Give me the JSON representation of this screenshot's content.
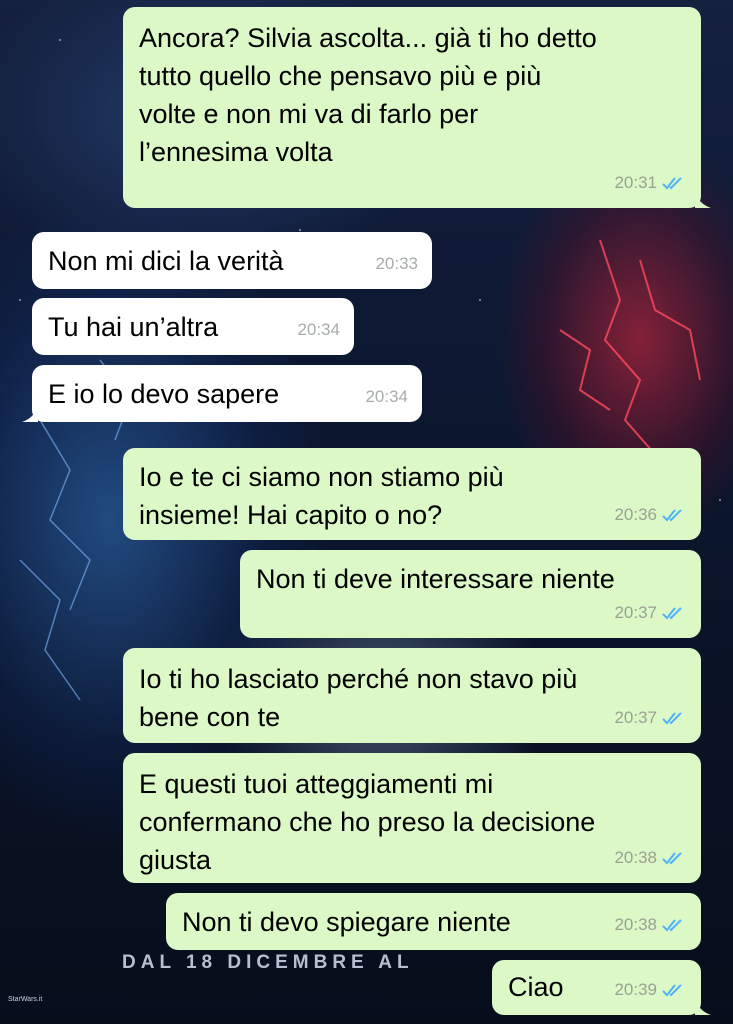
{
  "chat": {
    "messages": [
      {
        "dir": "out",
        "lines": [
          "Ancora? Silvia ascolta... già ti ho detto",
          "tutto quello che pensavo più e più",
          "volte e non mi va di farlo per",
          "l’ennesima volta"
        ],
        "time": "20:31",
        "read": true
      },
      {
        "dir": "in",
        "lines": [
          "Non mi dici la verità"
        ],
        "time": "20:33"
      },
      {
        "dir": "in",
        "lines": [
          "Tu hai un’altra"
        ],
        "time": "20:34"
      },
      {
        "dir": "in",
        "lines": [
          "E io lo devo sapere"
        ],
        "time": "20:34"
      },
      {
        "dir": "out",
        "lines": [
          "Io e te ci siamo non stiamo più",
          "insieme! Hai capito o no?"
        ],
        "time": "20:36",
        "read": true
      },
      {
        "dir": "out",
        "lines": [
          "Non ti deve interessare niente"
        ],
        "time": "20:37",
        "read": true
      },
      {
        "dir": "out",
        "lines": [
          "Io ti ho lasciato perché non stavo più",
          "bene con te"
        ],
        "time": "20:37",
        "read": true
      },
      {
        "dir": "out",
        "lines": [
          "E questi tuoi atteggiamenti mi",
          "confermano che ho preso la decisione",
          "giusta"
        ],
        "time": "20:38",
        "read": true
      },
      {
        "dir": "out",
        "lines": [
          "Non ti devo spiegare niente"
        ],
        "time": "20:38",
        "read": true
      },
      {
        "dir": "out",
        "lines": [
          "Ciao"
        ],
        "time": "20:39",
        "read": true
      }
    ]
  },
  "wallpaper": {
    "tagline": "DAL 18 DICEMBRE AL",
    "logo": "StarWars.it"
  },
  "colors": {
    "outgoing_bubble": "#dcf8c6",
    "incoming_bubble": "#ffffff",
    "read_ticks": "#4fb3f6",
    "timestamp": "#9aa294"
  }
}
